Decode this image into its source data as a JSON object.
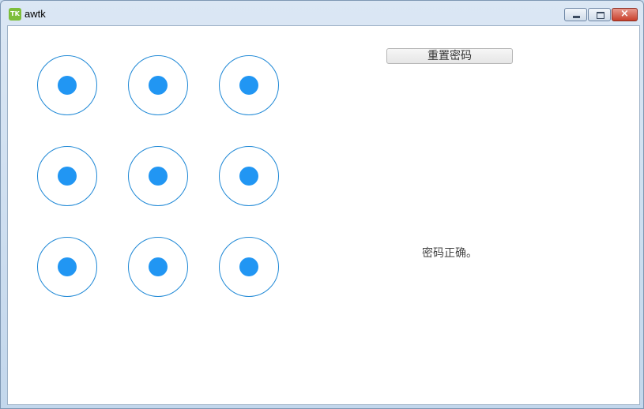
{
  "window": {
    "title": "awtk",
    "icon_label": "TK",
    "controls": {
      "minimize": "minimize-icon",
      "maximize": "maximize-icon",
      "close": "×"
    }
  },
  "colors": {
    "node_ring": "#1e88d6",
    "node_dot": "#2196f3",
    "client_bg": "#ffffff"
  },
  "pattern_lock": {
    "rows": 3,
    "cols": 3,
    "nodes": [
      {
        "id": 1,
        "state": "active"
      },
      {
        "id": 2,
        "state": "active"
      },
      {
        "id": 3,
        "state": "active"
      },
      {
        "id": 4,
        "state": "active"
      },
      {
        "id": 5,
        "state": "active"
      },
      {
        "id": 6,
        "state": "active"
      },
      {
        "id": 7,
        "state": "active"
      },
      {
        "id": 8,
        "state": "active"
      },
      {
        "id": 9,
        "state": "active"
      }
    ]
  },
  "controls": {
    "reset_label": "重置密码",
    "status": "密码正确。"
  }
}
